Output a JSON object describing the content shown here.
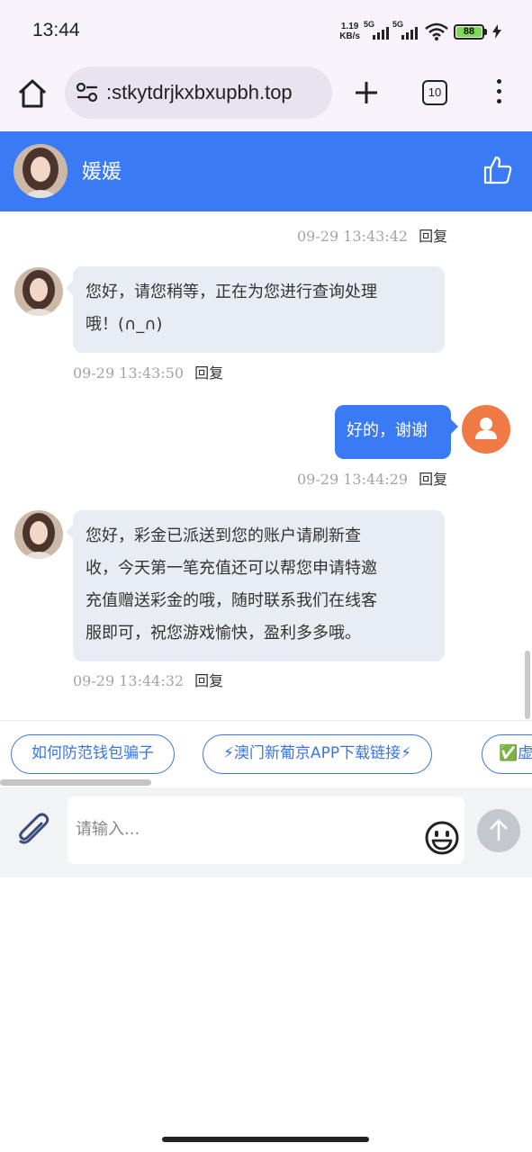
{
  "status_bar": {
    "time": "13:44",
    "net_speed_value": "1.19",
    "net_speed_unit": "KB/s",
    "sim1_label": "5G",
    "sim2_label": "5G",
    "battery": "88",
    "battery_color": "#7ed957"
  },
  "browser": {
    "url": ":stkytdrjkxbxupbh.top",
    "tab_count": "10",
    "icons": [
      "home-icon",
      "site-settings-icon",
      "plus-icon",
      "tabs-icon",
      "more-menu-icon"
    ]
  },
  "chat_header": {
    "agent_name": "媛媛",
    "accent_color": "#3a7bf5",
    "icons": [
      "agent-avatar",
      "thumbs-up-icon"
    ]
  },
  "messages": [
    {
      "type": "meta",
      "timestamp": "09-29 13:43:42",
      "reply_label": "回复"
    },
    {
      "type": "incoming",
      "text_lines": [
        "您好，请您稍等，正在为您进行查询处理",
        "哦！(∩_∩)"
      ],
      "timestamp": "09-29 13:43:50",
      "reply_label": "回复"
    },
    {
      "type": "outgoing",
      "text": "好的，谢谢",
      "timestamp": "09-29 13:44:29",
      "reply_label": "回复"
    },
    {
      "type": "incoming",
      "text_lines": [
        "您好，彩金已派送到您的账户请刷新查",
        "收，今天第一笔充值还可以帮您申请特邀",
        "充值赠送彩金的哦，随时联系我们在线客",
        "服即可，祝您游戏愉快，盈利多多哦。"
      ],
      "timestamp": "09-29 13:44:32",
      "reply_label": "回复"
    }
  ],
  "quick_replies": [
    "如何防范钱包骗子",
    "⚡澳门新葡京APP下载链接⚡",
    "✅虚"
  ],
  "composer": {
    "placeholder": "请输入...",
    "icons": [
      "paperclip-icon",
      "emoji-icon",
      "send-arrow-icon"
    ]
  }
}
